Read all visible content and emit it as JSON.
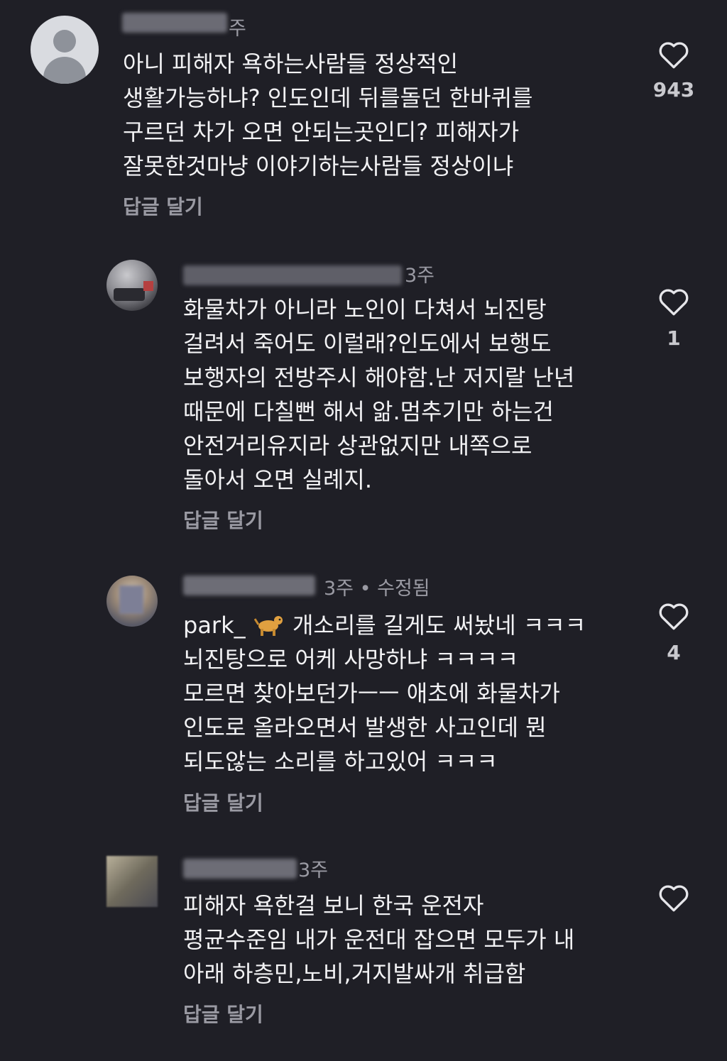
{
  "comments": [
    {
      "time": "주",
      "text": "아니 피해자 욕하는사람들 정상적인\n생활가능하냐? 인도인데 뒤를돌던 한바퀴를\n구르던 차가 오면 안되는곳인디? 피해자가\n잘못한것마냥 이야기하는사람들 정상이냐",
      "reply_label": "답글 달기",
      "like_count": "943"
    },
    {
      "time": "3주",
      "text": "화물차가 아니라 노인이 다쳐서 뇌진탕\n걸려서 죽어도 이럴래?인도에서 보행도\n보행자의 전방주시 해야함.난 저지랄 난년\n때문에 다칠뻔 해서 앎.멈추기만 하는건\n안전거리유지라 상관없지만 내쪽으로\n돌아서 오면 실례지.",
      "reply_label": "답글 달기",
      "like_count": "1"
    },
    {
      "time": "3주 • 수정됨",
      "mention": "park_",
      "text_after_mention": "개소리를 길게도 써놨네 ㅋㅋㅋ",
      "text": "뇌진탕으로 어케 사망하냐 ㅋㅋㅋㅋ\n모르면 찾아보던가ㅡㅡ 애초에 화물차가\n인도로 올라오면서 발생한 사고인데 뭔\n되도않는 소리를 하고있어 ㅋㅋㅋ",
      "reply_label": "답글 달기",
      "like_count": "4"
    },
    {
      "time": "3주",
      "text": "피해자 욕한걸 보니 한국 운전자\n평균수준임 내가 운전대 잡으면 모두가 내\n아래 하층민,노비,거지발싸개 취급함",
      "reply_label": "답글 달기",
      "like_count": ""
    }
  ],
  "icons": {
    "like": "heart-outline-icon",
    "emoji": "dog-emoji-icon"
  },
  "colors": {
    "background": "#1f1f26",
    "text": "#f2f2f4",
    "muted": "#9a9aa3"
  }
}
